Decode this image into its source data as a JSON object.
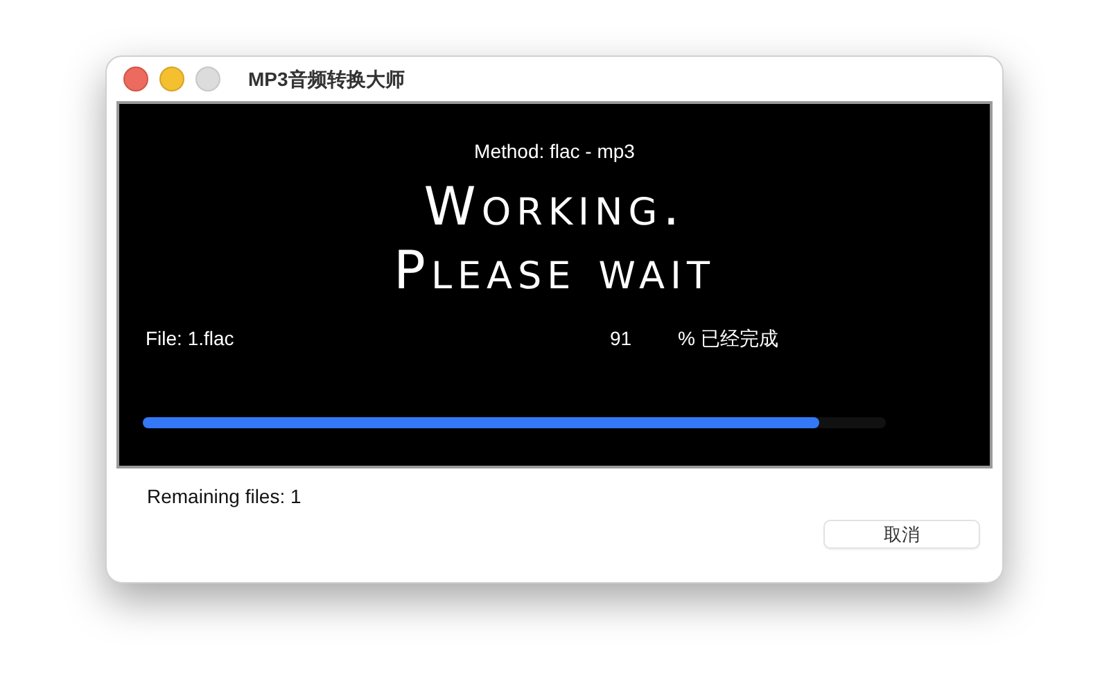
{
  "window": {
    "title": "MP3音频转换大师"
  },
  "panel": {
    "method": "Method: flac - mp3",
    "heading_1": "Working.",
    "heading_2": "Please wait",
    "file": "File: 1.flac",
    "percent": "91",
    "percent_label": "% 已经完成",
    "progress": {
      "level": 0.91
    }
  },
  "remaining": "Remaining files: 1",
  "buttons": [
    "取消"
  ]
}
